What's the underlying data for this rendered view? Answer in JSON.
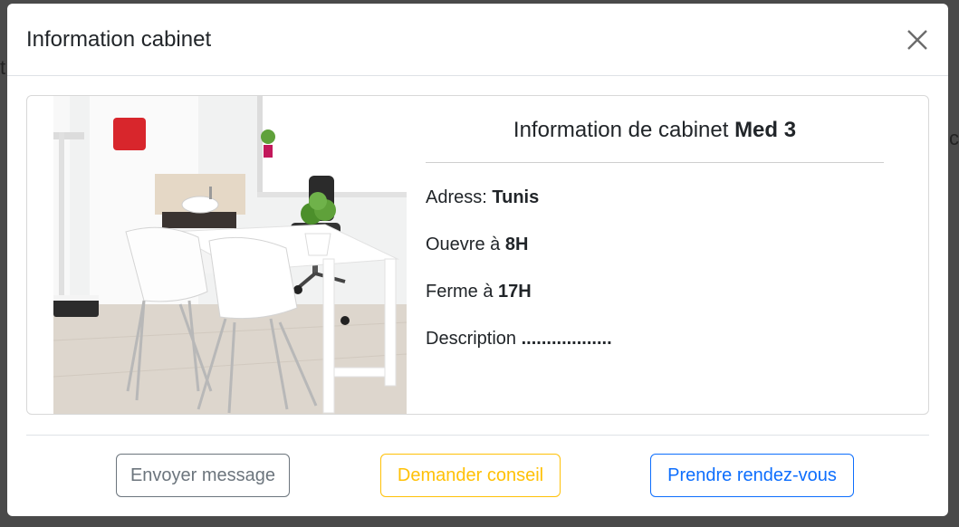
{
  "modal": {
    "title": "Information cabinet"
  },
  "cabinet": {
    "heading_prefix": "Information de cabinet",
    "heading_name": "Med 3",
    "address_label": "Adress:",
    "address_value": "Tunis",
    "open_label": "Ouevre à",
    "open_value": "8H",
    "close_label": "Ferme à",
    "close_value": "17H",
    "description_label": "Description",
    "description_value": "..................",
    "photo_icon": "office-room-photo"
  },
  "buttons": {
    "message": "Envoyer message",
    "advice": "Demander conseil",
    "appointment": "Prendre rendez-vous"
  },
  "colors": {
    "secondary": "#6c757d",
    "warning": "#ffc107",
    "primary": "#0d6efd"
  }
}
